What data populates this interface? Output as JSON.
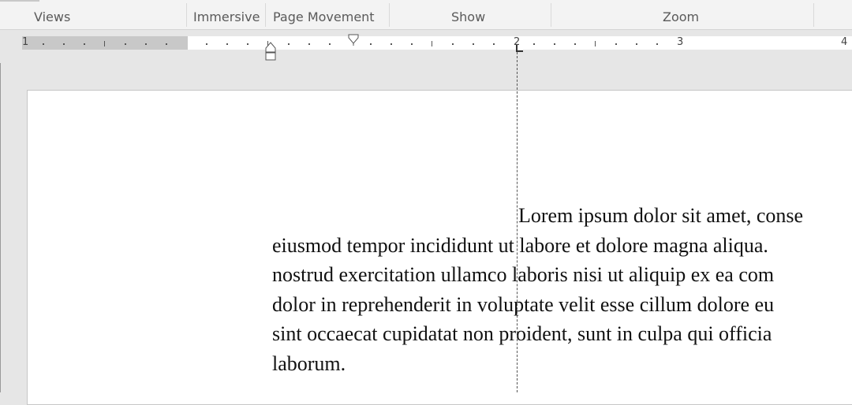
{
  "ribbon": {
    "groups": [
      {
        "label": "Views"
      },
      {
        "label": "Immersive"
      },
      {
        "label": "Page Movement"
      },
      {
        "label": "Show"
      },
      {
        "label": "Zoom"
      }
    ]
  },
  "ruler": {
    "numbers": [
      "1",
      "2",
      "3",
      "4"
    ],
    "unit": "inches"
  },
  "document": {
    "lines": [
      "Lorem ipsum dolor sit amet, conse",
      "eiusmod tempor incididunt ut labore et dolore magna aliqua.",
      "nostrud exercitation ullamco laboris nisi ut aliquip ex ea com",
      "dolor in reprehenderit in voluptate velit esse cillum dolore eu",
      "sint occaecat cupidatat non proident, sunt in culpa qui officia",
      "laborum."
    ]
  },
  "colors": {
    "ribbon_bg": "#f3f3f3",
    "workspace_bg": "#e6e6e6",
    "ruler_margin": "#c8c8c8",
    "page_bg": "#ffffff"
  },
  "icons": {
    "first_line_indent": "first-line-indent-marker-icon",
    "hanging_indent": "hanging-indent-marker-icon",
    "tab_stop": "left-tab-stop-icon"
  }
}
